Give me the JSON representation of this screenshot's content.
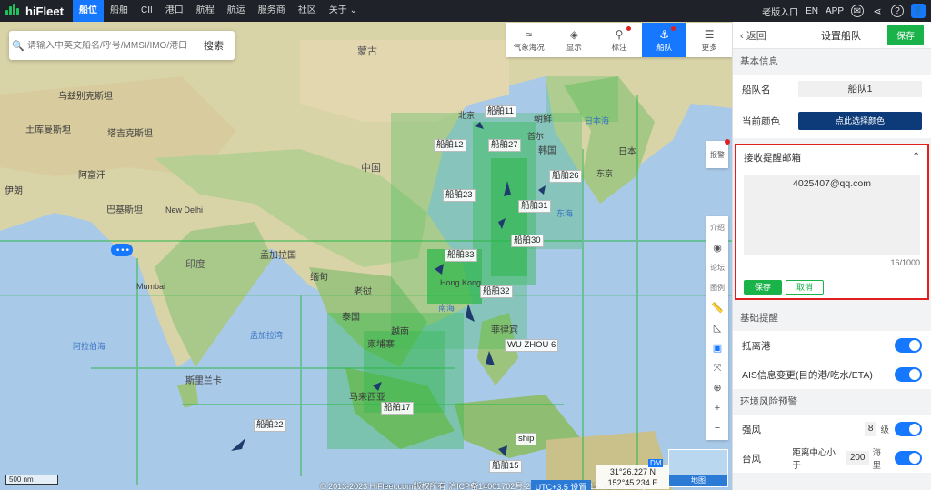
{
  "nav": {
    "logo": "hiFleet",
    "items": [
      "船位",
      "船舶",
      "CII",
      "港口",
      "航程",
      "航运",
      "服务商",
      "社区",
      "关于"
    ],
    "right": [
      "老版入口",
      "EN",
      "APP"
    ]
  },
  "search": {
    "placeholder": "请输入中英文船名/呼号/MMSI/IMO/港口",
    "button": "搜索"
  },
  "tools": [
    "气象海况",
    "显示",
    "标注",
    "船队",
    "更多"
  ],
  "side_tools": [
    "介绍",
    "论坛",
    "图例"
  ],
  "alarm": "报警",
  "map_labels": {
    "mongolia": "蒙古",
    "china": "中国",
    "india": "印度",
    "japan": "日本",
    "korea": "韩国",
    "nk": "朝鲜",
    "uzbek": "乌兹别克斯坦",
    "turkmen": "土库曼斯坦",
    "tajik": "塔吉克斯坦",
    "afghan": "阿富汗",
    "pakistan": "巴基斯坦",
    "iran": "伊朗",
    "bangladesh": "孟加拉国",
    "myanmar": "缅甸",
    "laos": "老挝",
    "thailand": "泰国",
    "vietnam": "越南",
    "cambodia": "柬埔寨",
    "malaysia": "马来西亚",
    "philippines": "菲律宾",
    "srilanka": "斯里兰卡",
    "newdelhi": "New Delhi",
    "beijing": "北京",
    "seoul": "首尔",
    "tokyo": "东京",
    "hongkong": "Hong Kong",
    "mumbai": "Mumbai",
    "sea_japan": "日本海",
    "sea_east": "东海",
    "sea_south": "南海",
    "sea_arabian": "阿拉伯海",
    "sea_bengal": "孟加拉湾"
  },
  "ships": [
    "船舶11",
    "船舶12",
    "船舶27",
    "船舶26",
    "船舶23",
    "船舶31",
    "船舶30",
    "船舶33",
    "船舶32",
    "WU ZHOU 6",
    "船舶17",
    "船舶22",
    "ship",
    "船舶15"
  ],
  "coords": {
    "lat": "31°26.227 N",
    "lon": "152°45.234 E",
    "dm": "DM"
  },
  "utc": "UTC+3.5 设置",
  "minimap": "地图",
  "scale": "500 nm",
  "copyright": "© 2013-2023 HiFleet.com版权所有 沪ICP备14001702号-2 沪公网安备 31011502008480号",
  "panel": {
    "back": "返回",
    "title": "设置船队",
    "save": "保存",
    "basic": "基本信息",
    "fleet_label": "船队名",
    "fleet_name": "船队1",
    "color_label": "当前颜色",
    "color_btn": "点此选择颜色",
    "email_title": "接收提醒邮箱",
    "email_value": "4025407@qq.com",
    "email_count": "16/1000",
    "btn_save": "保存",
    "btn_cancel": "取消",
    "base_alert": "基础提醒",
    "arrive": "抵离港",
    "ais_change": "AIS信息变更(目的港/吃水/ETA)",
    "env": "环境风险预警",
    "wind": "强风",
    "wind_val": "8",
    "wind_unit": "级",
    "typhoon": "台风",
    "typhoon_dist": "距离中心小于",
    "typhoon_val": "200",
    "typhoon_unit": "海里"
  }
}
